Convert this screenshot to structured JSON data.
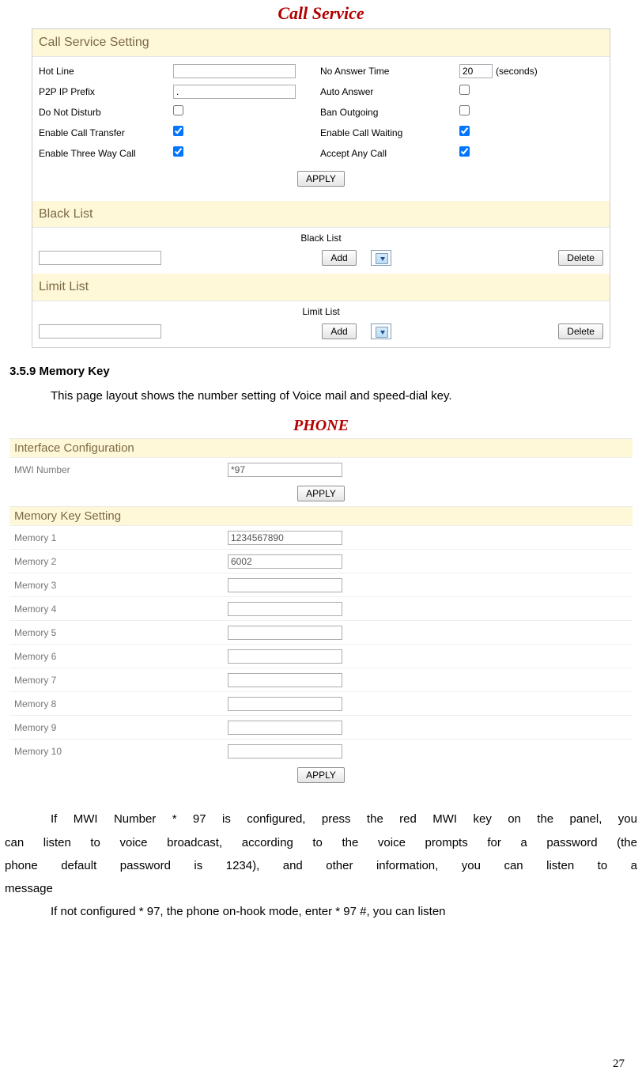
{
  "callService": {
    "title": "Call Service",
    "settingHeader": "Call Service Setting",
    "labels": {
      "hotLine": "Hot Line",
      "noAnswerTime": "No Answer Time",
      "seconds": "(seconds)",
      "p2p": "P2P IP Prefix",
      "autoAnswer": "Auto Answer",
      "dnd": "Do Not Disturb",
      "banOutgoing": "Ban Outgoing",
      "transfer": "Enable Call Transfer",
      "waiting": "Enable Call Waiting",
      "threeway": "Enable Three Way Call",
      "acceptAny": "Accept Any Call"
    },
    "values": {
      "hotLine": "",
      "noAnswerTime": "20",
      "p2p": ".",
      "autoAnswer": false,
      "dnd": false,
      "banOutgoing": false,
      "transfer": true,
      "waiting": true,
      "threeway": true,
      "acceptAny": true
    },
    "apply": "APPLY",
    "blackList": {
      "header": "Black List",
      "title": "Black List",
      "add": "Add",
      "delete": "Delete",
      "input": ""
    },
    "limitList": {
      "header": "Limit List",
      "title": "Limit List",
      "add": "Add",
      "delete": "Delete",
      "input": ""
    }
  },
  "doc": {
    "h": "3.5.9 Memory Key",
    "p1": "This page layout shows the number setting of Voice mail and speed-dial key.",
    "p2": "If MWI  Number  * 97 is  configured,  press the  red  MWI key on  the  panel,  you",
    "p3": "can listen to voice broadcast, according to the voice prompts for a password (the",
    "p4": "phone default   password   is 1234),   and   other information,   you   can listen   to a",
    "p5": "message",
    "p6": "If not configured * 97, the phone on-hook mode, enter * 97 #, you can listen"
  },
  "phone": {
    "title": "PHONE",
    "ifConf": "Interface Configuration",
    "mwiLabel": "MWI Number",
    "mwiValue": "*97",
    "memHeader": "Memory Key Setting",
    "apply": "APPLY",
    "mem": [
      {
        "label": "Memory 1",
        "value": "1234567890"
      },
      {
        "label": "Memory 2",
        "value": "6002"
      },
      {
        "label": "Memory 3",
        "value": ""
      },
      {
        "label": "Memory 4",
        "value": ""
      },
      {
        "label": "Memory 5",
        "value": ""
      },
      {
        "label": "Memory 6",
        "value": ""
      },
      {
        "label": "Memory 7",
        "value": ""
      },
      {
        "label": "Memory 8",
        "value": ""
      },
      {
        "label": "Memory 9",
        "value": ""
      },
      {
        "label": "Memory 10",
        "value": ""
      }
    ]
  },
  "pageNumber": "27"
}
